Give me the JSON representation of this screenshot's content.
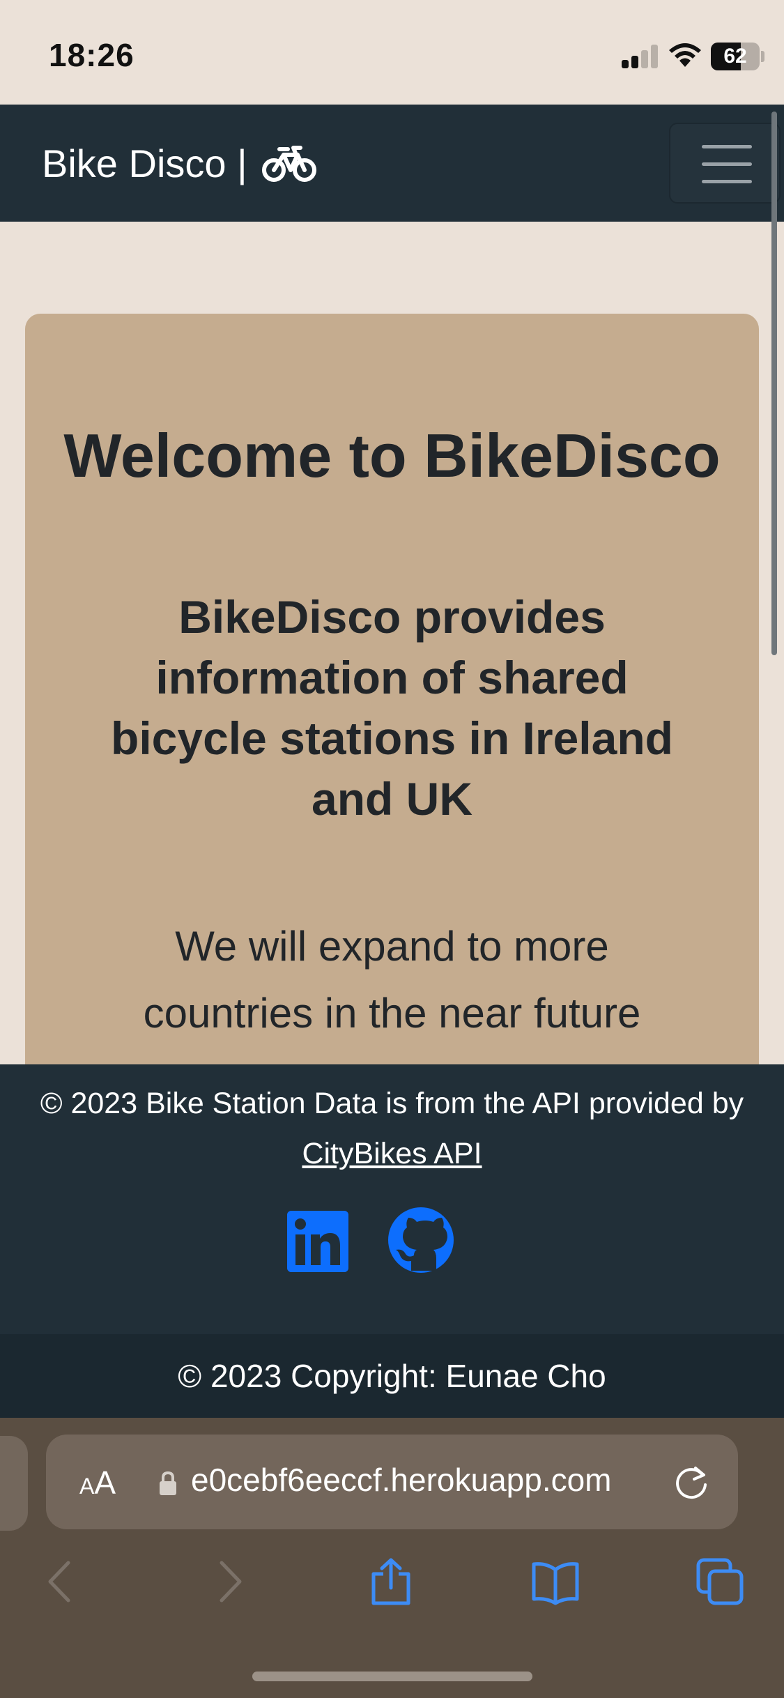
{
  "status_bar": {
    "time": "18:26",
    "battery": "62",
    "battery_level": 0.62,
    "signal_bars_active": 2,
    "signal_bars_total": 4
  },
  "navbar": {
    "brand": "Bike Disco |",
    "brand_icon": "bicycle-icon",
    "toggler_icon": "hamburger-icon"
  },
  "welcome_card": {
    "title": "Welcome to BikeDisco",
    "subtitle": "BikeDisco provides information of shared bicycle stations in Ireland and UK",
    "body": "We will expand to more countries in the near future"
  },
  "footer": {
    "attribution": "© 2023 Bike Station Data is from the API provided by",
    "api_link": "CityBikes API",
    "social_icons": [
      "linkedin-icon",
      "github-icon"
    ],
    "copyright": "© 2023 Copyright: Eunae Cho"
  },
  "browser": {
    "aa_label_small": "A",
    "aa_label_large": "A",
    "url": "e0cebf6eeccf.herokuapp.com",
    "toolbar_icons": [
      "back-icon",
      "forward-icon",
      "share-icon",
      "bookmarks-icon",
      "tabs-icon"
    ]
  },
  "colors": {
    "page_bg": "#ebe1d8",
    "navbar_bg": "#212f38",
    "card_bg": "#c5ac8f",
    "link_blue": "#0d6efd",
    "safari_bg": "#5a4e42"
  }
}
